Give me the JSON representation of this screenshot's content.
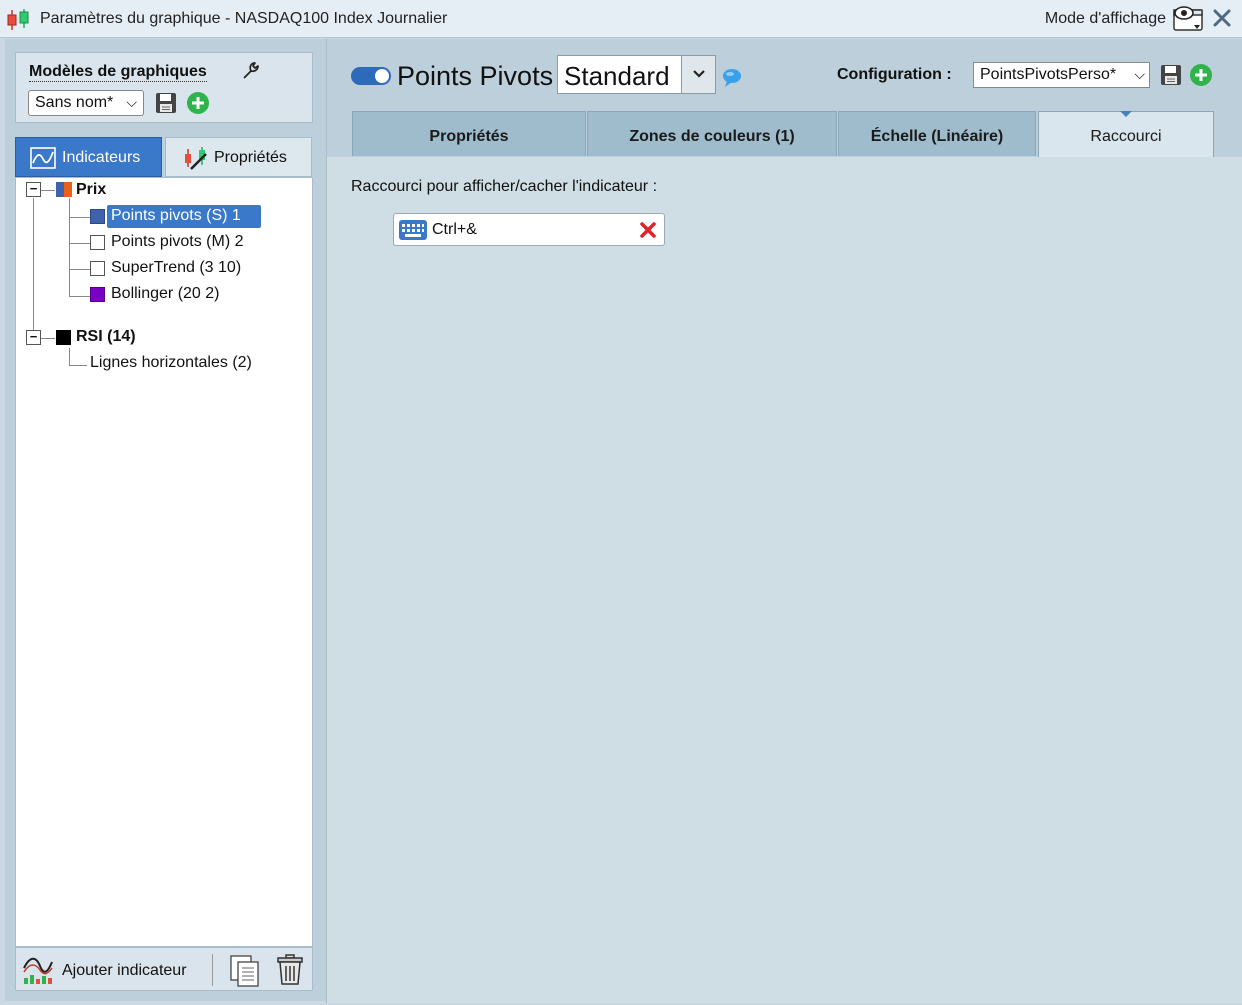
{
  "window": {
    "title": "Paramètres du graphique - NASDAQ100 Index Journalier",
    "mode_label": "Mode d'affichage"
  },
  "left": {
    "models_title": "Modèles de graphiques",
    "model_select": "Sans nom*",
    "tabs": [
      {
        "label": "Indicateurs",
        "active": true
      },
      {
        "label": "Propriétés",
        "active": false
      }
    ],
    "tree": {
      "groups": [
        {
          "label": "Prix",
          "swatch": "#e8611c",
          "items": [
            {
              "label": "Points pivots (S) 1",
              "swatch": "#3f62ad",
              "selected": true
            },
            {
              "label": "Points pivots (M) 2",
              "swatch": "#ffffff",
              "selected": false
            },
            {
              "label": "SuperTrend (3 10)",
              "swatch": "#ffffff",
              "selected": false
            },
            {
              "label": "Bollinger (20 2)",
              "swatch": "#7a00c8",
              "selected": false
            }
          ]
        },
        {
          "label": "RSI (14)",
          "swatch": "#000000",
          "items": [
            {
              "label": "Lignes horizontales (2)",
              "selected": false
            }
          ]
        }
      ]
    },
    "add_indicator_label": "Ajouter indicateur"
  },
  "right": {
    "indicator_name": "Points Pivots",
    "enabled": true,
    "style_select": "Standard",
    "config_label": "Configuration :",
    "config_select": "PointsPivotsPerso*",
    "tabs": [
      {
        "label": "Propriétés",
        "active": false
      },
      {
        "label": "Zones de couleurs (1)",
        "active": false
      },
      {
        "label": "Échelle (Linéaire)",
        "active": false
      },
      {
        "label": "Raccourci",
        "active": true
      }
    ],
    "shortcut_prompt": "Raccourci pour afficher/cacher l'indicateur :",
    "shortcut_value": "Ctrl+&"
  },
  "colors": {
    "accent_blue": "#3a78c9",
    "panel_bg": "#bccfdb",
    "content_bg": "#cfdde5",
    "tab_inactive": "#9fbccc",
    "add_green": "#2fb34a",
    "clear_red": "#e0232a"
  },
  "icons": {
    "app": "candlestick-chart-icon",
    "view_mode": "eye-window-icon",
    "close": "close-icon",
    "wrench": "wrench-icon",
    "save": "floppy-disk-icon",
    "add": "plus-circle-icon",
    "indicators_tab": "line-chart-icon",
    "properties_tab": "paint-brush-icon",
    "comment": "speech-bubble-icon",
    "keyboard": "keyboard-icon",
    "clear": "red-x-icon",
    "add_indicator": "indicator-chart-icon",
    "duplicate": "copy-document-icon",
    "delete": "trash-can-icon"
  }
}
